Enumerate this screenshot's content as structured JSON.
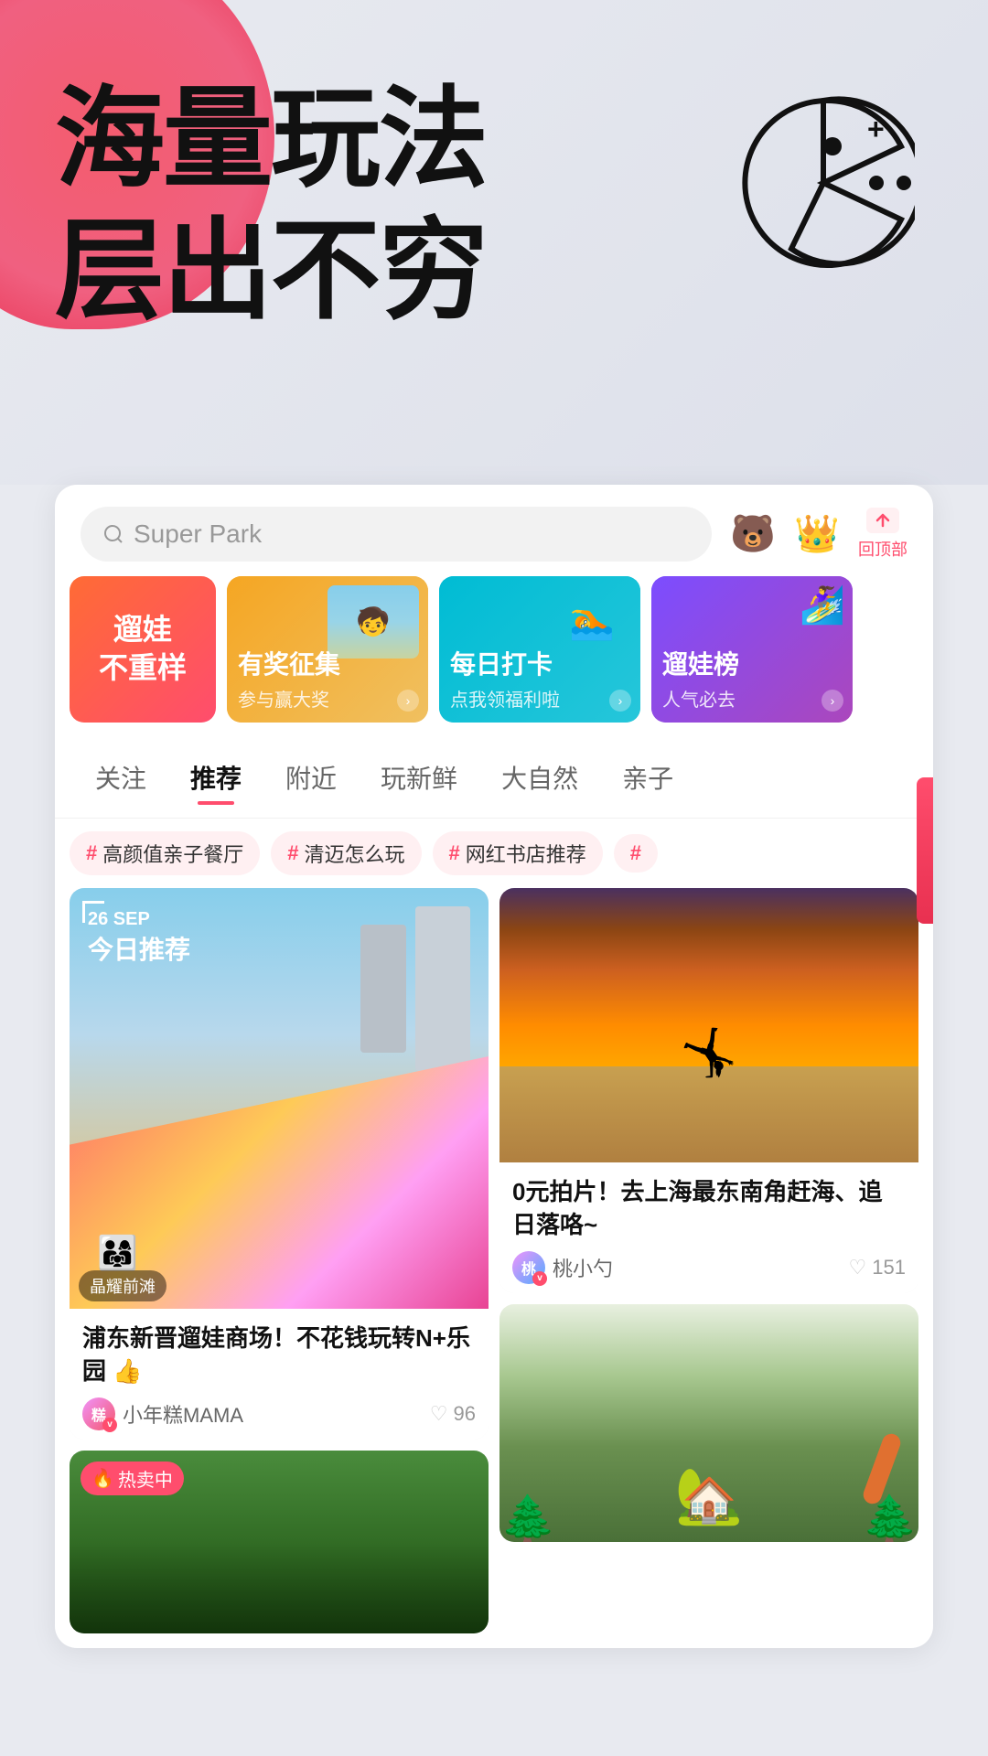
{
  "hero": {
    "title_line1": "海量玩法",
    "title_line2": "层出不穷"
  },
  "search": {
    "placeholder": "Super Park"
  },
  "icons": {
    "bear_emoji": "🐻",
    "crown_emoji": "👑",
    "top_label": "回顶部"
  },
  "banners": [
    {
      "id": 1,
      "title": "遛娃\n不重样",
      "type": "red"
    },
    {
      "id": 2,
      "title": "有奖征集",
      "subtitle": "参与赢大奖",
      "type": "orange"
    },
    {
      "id": 3,
      "title": "每日打卡",
      "subtitle": "点我领福利啦",
      "type": "cyan"
    },
    {
      "id": 4,
      "title": "遛娃榜",
      "subtitle": "人气必去",
      "type": "purple"
    }
  ],
  "nav_tabs": [
    {
      "id": "follow",
      "label": "关注",
      "active": false
    },
    {
      "id": "recommend",
      "label": "推荐",
      "active": true
    },
    {
      "id": "nearby",
      "label": "附近",
      "active": false
    },
    {
      "id": "fresh",
      "label": "玩新鲜",
      "active": false
    },
    {
      "id": "nature",
      "label": "大自然",
      "active": false
    },
    {
      "id": "family",
      "label": "亲子",
      "active": false
    }
  ],
  "tags": [
    {
      "id": "tag1",
      "text": "高颜值亲子餐厅"
    },
    {
      "id": "tag2",
      "text": "清迈怎么玩"
    },
    {
      "id": "tag3",
      "text": "网红书店推荐"
    }
  ],
  "cards": [
    {
      "id": "card1",
      "date": "26 SEP",
      "date_label": "今日推荐",
      "location": "晶耀前滩",
      "title": "浦东新晋遛娃商场！不花钱玩转N+乐园 👍",
      "author": "小年糕MAMA",
      "likes": 96
    },
    {
      "id": "card2",
      "title": "0元拍片！去上海最东南角赶海、追日落咯~",
      "author": "桃小勺",
      "likes": 151
    },
    {
      "id": "card3",
      "hot_label": "热卖中",
      "type": "bottom_left"
    },
    {
      "id": "card4",
      "type": "bottom_right"
    }
  ]
}
